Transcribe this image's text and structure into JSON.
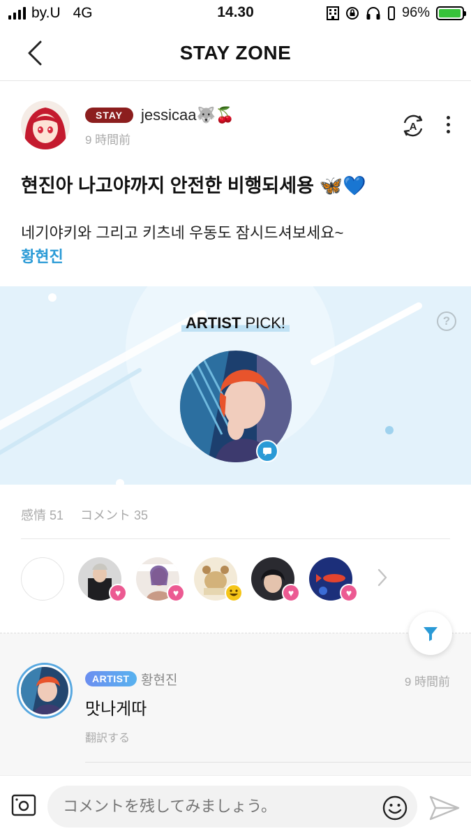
{
  "status_bar": {
    "carrier": "by.U",
    "network": "4G",
    "time": "14.30",
    "battery": "96%",
    "battery_level": 0.96
  },
  "nav": {
    "title": "STAY ZONE",
    "back_icon": "chevron-left-icon"
  },
  "post": {
    "badge": "STAY",
    "author": "jessicaa🐺🍒",
    "time": "9 時間前",
    "title": "현진아 나고야까지 안전한 비행되세용 🦋💙",
    "body": "네기야키와 그리고 키츠네 우동도 잠시드셔보세요~",
    "tag": "황현진"
  },
  "artist_pick": {
    "title_bold": "ARTIST",
    "title_rest": " PICK!",
    "help": "?"
  },
  "stats": {
    "reactions": "感情 51",
    "comments": "コメント 35"
  },
  "comment": {
    "badge": "ARTIST",
    "author": "황현진",
    "time": "9 時間前",
    "text": "맛나게따",
    "translate": "翻訳する"
  },
  "composer": {
    "placeholder": "コメントを残してみましょう。"
  },
  "colors": {
    "accent": "#2a9ad6",
    "stay_badge": "#8c1e1e",
    "heart": "#ec5a92",
    "pick_bg": "#e3f2fb"
  }
}
